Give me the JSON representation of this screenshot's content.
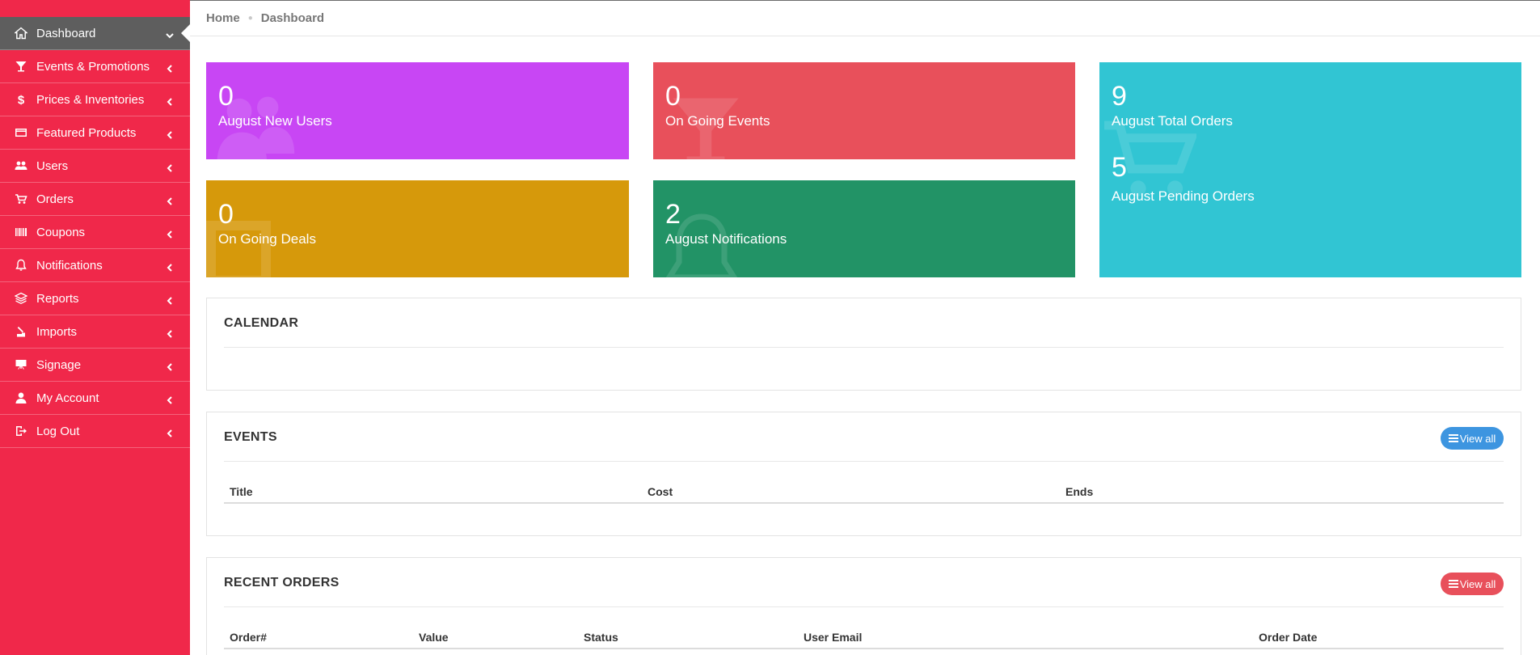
{
  "sidebar": {
    "items": [
      {
        "label": "Dashboard",
        "icon": "home-icon"
      },
      {
        "label": "Events & Promotions",
        "icon": "cocktail-icon"
      },
      {
        "label": "Prices & Inventories",
        "icon": "dollar-icon"
      },
      {
        "label": "Featured Products",
        "icon": "card-icon"
      },
      {
        "label": "Users",
        "icon": "users-icon"
      },
      {
        "label": "Orders",
        "icon": "cart-icon"
      },
      {
        "label": "Coupons",
        "icon": "barcode-icon"
      },
      {
        "label": "Notifications",
        "icon": "bell-icon"
      },
      {
        "label": "Reports",
        "icon": "layers-icon"
      },
      {
        "label": "Imports",
        "icon": "import-icon"
      },
      {
        "label": "Signage",
        "icon": "easel-icon"
      },
      {
        "label": "My Account",
        "icon": "user-icon"
      },
      {
        "label": "Log Out",
        "icon": "logout-icon"
      }
    ]
  },
  "breadcrumb": {
    "home": "Home",
    "current": "Dashboard"
  },
  "stats": {
    "new_users": {
      "value": "0",
      "label": "August New Users",
      "color": "#c846f4"
    },
    "ongoing_events": {
      "value": "0",
      "label": "On Going Events",
      "color": "#e8505b"
    },
    "total_orders": {
      "value": "9",
      "label": "August Total Orders",
      "color": "#31c5d3"
    },
    "pending_orders": {
      "value": "5",
      "label": "August Pending Orders"
    },
    "ongoing_deals": {
      "value": "0",
      "label": "On Going Deals",
      "color": "#d6990b"
    },
    "notifications": {
      "value": "2",
      "label": "August Notifications",
      "color": "#229366"
    }
  },
  "calendar": {
    "title": "CALENDAR"
  },
  "events": {
    "title": "EVENTS",
    "view_all": "View all",
    "columns": [
      "Title",
      "Cost",
      "Ends"
    ]
  },
  "recent_orders": {
    "title": "RECENT ORDERS",
    "view_all": "View all",
    "columns": [
      "Order#",
      "Value",
      "Status",
      "User Email",
      "Order Date"
    ]
  },
  "colors": {
    "sidebar": "#f0284a",
    "active_item": "#5e5e5e",
    "btn_blue": "#3d95e0",
    "btn_red": "#e8505b"
  }
}
